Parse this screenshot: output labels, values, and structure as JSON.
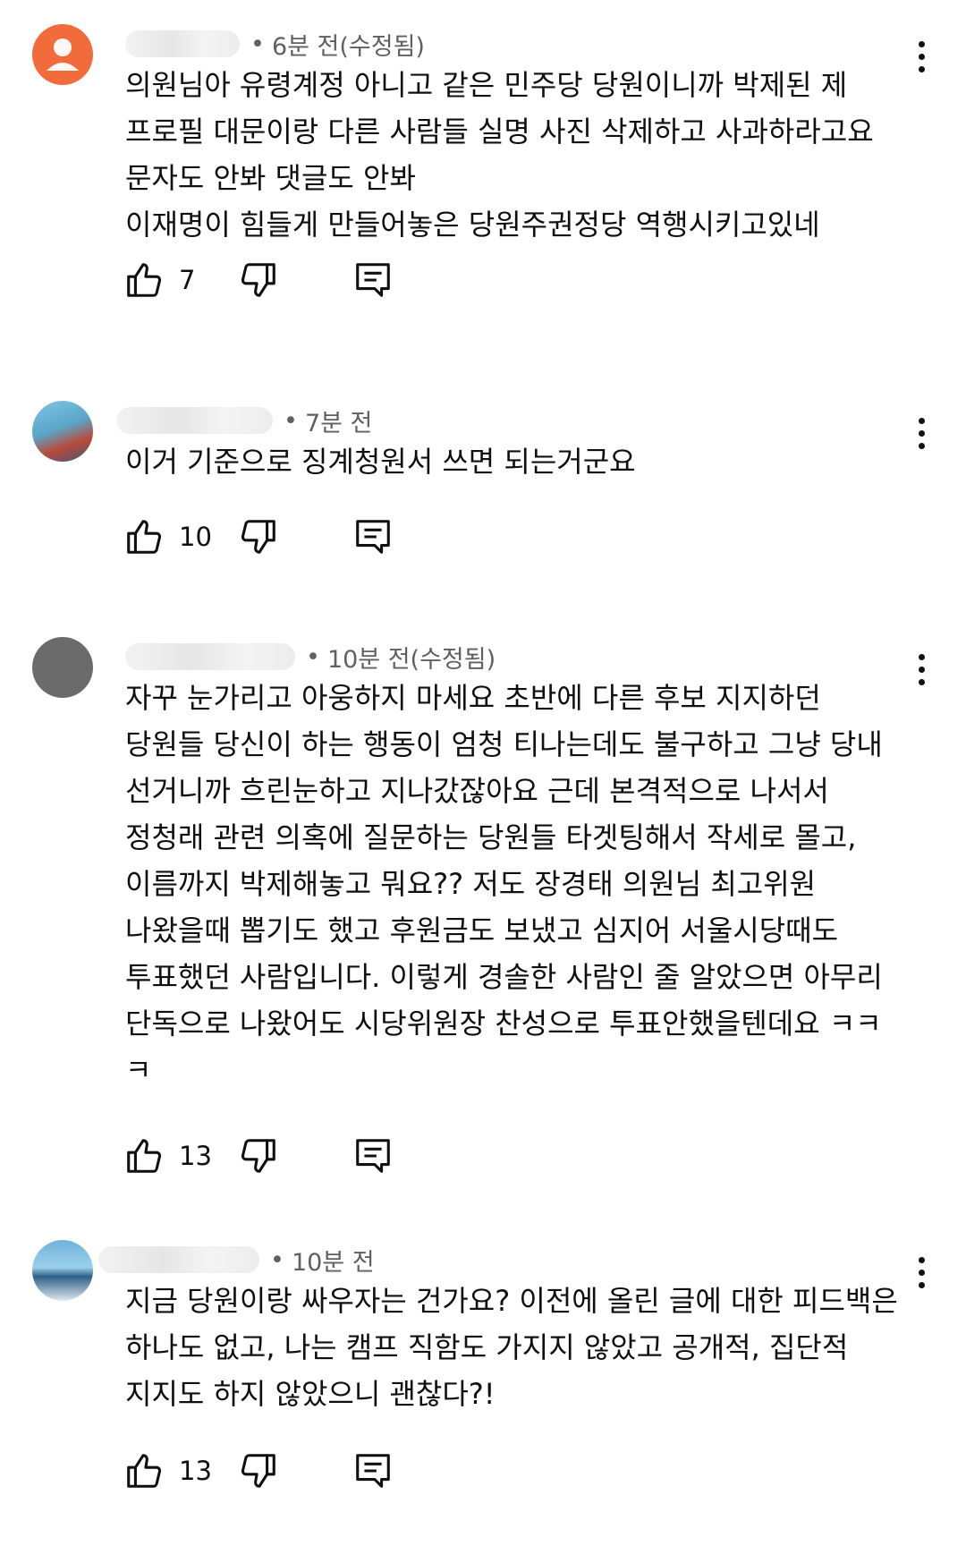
{
  "colors": {
    "avatar1": "#f26b3a",
    "avatar3": "#6b6b6b",
    "text": "#0f0f0f",
    "meta": "#606060"
  },
  "comments": [
    {
      "time": "6분 전(수정됨)",
      "text": "의원님아 유령계정 아니고 같은 민주당 당원이니까 박제된 제\n프로필 대문이랑 다른 사람들 실명 사진 삭제하고 사과하라고요\n문자도 안봐 댓글도 안봐\n이재명이 힘들게 만들어놓은 당원주권정당 역행시키고있네",
      "likes": "7"
    },
    {
      "time": "7분 전",
      "text": "이거 기준으로 징계청원서 쓰면 되는거군요",
      "likes": "10"
    },
    {
      "time": "10분 전(수정됨)",
      "text": "자꾸 눈가리고 아웅하지 마세요 초반에 다른 후보 지지하던\n당원들 당신이 하는 행동이 엄청 티나는데도 불구하고 그냥 당내\n선거니까 흐린눈하고 지나갔잖아요 근데 본격적으로 나서서\n정청래 관련 의혹에 질문하는 당원들 타겟팅해서 작세로 몰고,\n이름까지 박제해놓고 뭐요?? 저도 장경태 의원님 최고위원\n나왔을때 뽑기도 했고 후원금도 보냈고 심지어 서울시당때도\n투표했던 사람입니다. 이렇게 경솔한 사람인 줄 알았으면 아무리\n단독으로 나왔어도 시당위원장 찬성으로 투표안했을텐데요 ㅋㅋ\nㅋ",
      "likes": "13"
    },
    {
      "time": "10분 전",
      "text": "지금 당원이랑 싸우자는 건가요? 이전에 올린 글에 대한 피드백은\n하나도 없고, 나는 캠프 직함도 가지지 않았고 공개적, 집단적\n지지도 하지 않았으니 괜찮다?!",
      "likes": "13"
    }
  ],
  "icons": {
    "like": "thumbs-up-icon",
    "dislike": "thumbs-down-icon",
    "reply": "reply-icon",
    "more": "more-vert-icon"
  }
}
